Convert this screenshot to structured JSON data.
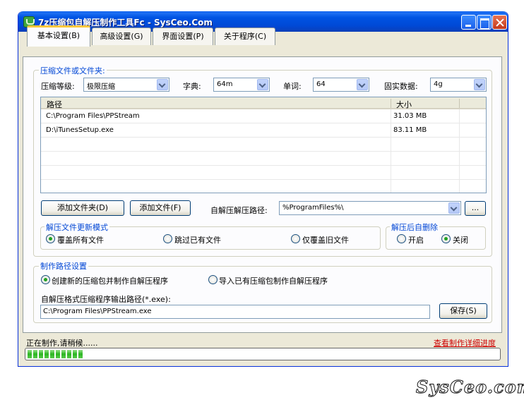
{
  "window": {
    "title": "7z压缩包自解压制作工具Fc - SysCeo.Com"
  },
  "tabs": [
    {
      "label": "基本设置(B)"
    },
    {
      "label": "高级设置(G)"
    },
    {
      "label": "界面设置(P)"
    },
    {
      "label": "关于程序(C)"
    }
  ],
  "compress_group": {
    "title": "压缩文件或文件夹:",
    "level_label": "压缩等级:",
    "level_value": "极限压缩",
    "dict_label": "字典:",
    "dict_value": "64m",
    "word_label": "单词:",
    "word_value": "64",
    "solid_label": "固实数据:",
    "solid_value": "4g"
  },
  "file_list": {
    "columns": [
      "路径",
      "大小"
    ],
    "rows": [
      {
        "path": "C:\\Program Files\\PPStream",
        "size": "31.03 MB"
      },
      {
        "path": "D:\\iTunesSetup.exe",
        "size": "83.11 MB"
      }
    ]
  },
  "actions": {
    "add_folder": "添加文件夹(D)",
    "add_file": "添加文件(F)",
    "extract_path_label": "自解压解压路径:",
    "extract_path_value": "%ProgramFiles%\\",
    "browse": "..."
  },
  "update_mode": {
    "title": "解压文件更新模式",
    "options": [
      "覆盖所有文件",
      "跳过已有文件",
      "仅覆盖旧文件"
    ],
    "selected": "覆盖所有文件"
  },
  "auto_delete": {
    "title": "解压后自删除",
    "options": [
      "开启",
      "关闭"
    ],
    "selected": "关闭"
  },
  "path_settings": {
    "title": "制作路径设置",
    "options": [
      "创建新的压缩包并制作自解压程序",
      "导入已有压缩包制作自解压程序"
    ],
    "selected": "创建新的压缩包并制作自解压程序",
    "output_label": "自解压格式压缩程序输出路径(*.exe):",
    "output_value": "C:\\Program Files\\PPStream.exe",
    "save": "保存(S)"
  },
  "status": {
    "text": "正在制作,请稍候......",
    "details_link": "查看制作详细进度",
    "progress_fraction": 0.12
  },
  "watermark": "SysCeo.com"
}
